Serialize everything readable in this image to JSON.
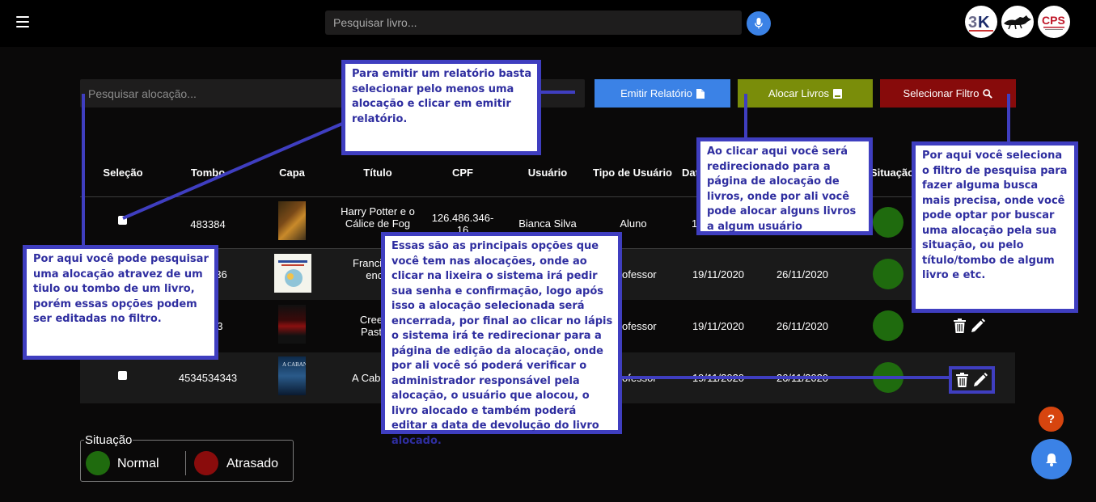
{
  "header": {
    "search_placeholder": "Pesquisar livro...",
    "logos": [
      "3K",
      "fox",
      "CPS"
    ]
  },
  "toolbar": {
    "alloc_search_placeholder": "Pesquisar alocação...",
    "report_label": "Emitir Relatório",
    "alloc_label": "Alocar Livros",
    "filter_label": "Selecionar Filtro"
  },
  "table": {
    "headers": [
      "Seleção",
      "Tombo",
      "Capa",
      "Título",
      "CPF",
      "Usuário",
      "Tipo de Usuário",
      "Dat",
      "Situação"
    ],
    "rows": [
      {
        "tombo": "483384",
        "titulo": "Harry Potter e o Cálice de Fog",
        "cpf": "126.486.346-16",
        "usuario": "Bianca Silva",
        "tipo": "Aluno",
        "data": "1",
        "devolucao": ""
      },
      {
        "tombo": "836",
        "titulo": "Francis jard encan",
        "cpf": "",
        "usuario": "",
        "tipo": "ofessor",
        "data": "19/11/2020",
        "devolucao": "26/11/2020"
      },
      {
        "tombo": "33",
        "titulo": "Cree Past",
        "cpf": "",
        "usuario": "",
        "tipo": "ofessor",
        "data": "19/11/2020",
        "devolucao": "26/11/2020"
      },
      {
        "tombo": "4534534343",
        "titulo": "A Cab",
        "cpf": "",
        "usuario": "",
        "tipo": "ofessor",
        "data": "19/11/2020",
        "devolucao": "26/11/2020"
      }
    ]
  },
  "notes": {
    "report": "Para emitir um relatório basta selecionar pelo menos uma alocação e clicar em emitir relatório.",
    "alloc": "Ao clicar aqui você será redirecionado para a página de alocação de livros, onde por ali você pode alocar alguns livros a algum usuário",
    "filter": "Por aqui você seleciona o filtro de pesquisa para fazer alguma busca mais precisa, onde você pode optar por buscar uma alocação pela sua situação, ou pelo título/tombo de algum livro e etc.",
    "search": "Por aqui você pode pesquisar uma alocação atravez de um tiulo ou tombo de um livro, porém essas opções podem ser editadas no filtro.",
    "actions": "Essas são as principais opções que você tem nas alocações, onde ao clicar na lixeira o sistema irá pedir sua senha e confirmação, logo após isso a alocação selecionada será encerrada, por final ao clicar no lápis o sistema irá te redirecionar para a página de edição da alocação, onde por ali você só poderá verificar o administrador responsável pela alocação, o usuário que alocou, o livro alocado e também poderá editar a data de devolução do livro alocado."
  },
  "legend": {
    "title": "Situação",
    "normal_label": "Normal",
    "late_label": "Atrasado",
    "normal_color": "#1f6b0e",
    "late_color": "#8a0c0c"
  },
  "fab": {
    "help_label": "?"
  }
}
